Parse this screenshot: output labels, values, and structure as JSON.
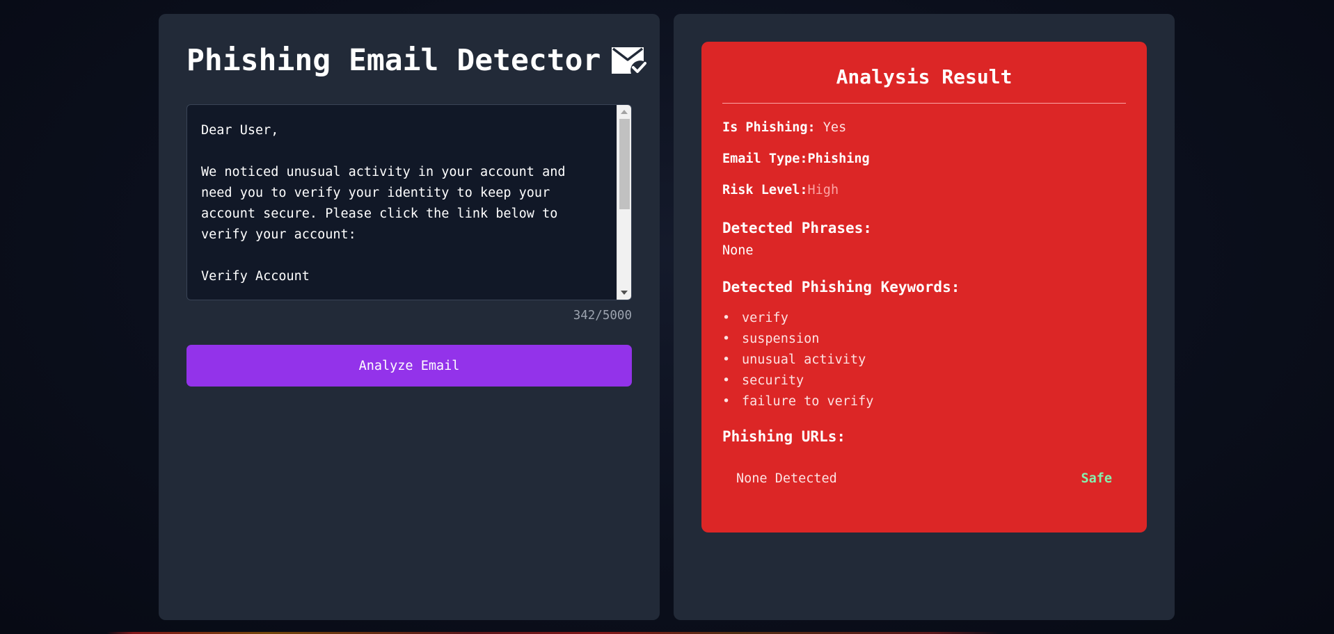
{
  "app": {
    "title": "Phishing Email Detector",
    "title_icon": "mail-check-icon"
  },
  "input": {
    "email_text": "Dear User,\n\nWe noticed unusual activity in your account and need you to verify your identity to keep your account secure. Please click the link below to verify your account:\n\nVerify Account",
    "char_count": "342/5000",
    "analyze_label": "Analyze Email"
  },
  "result": {
    "title": "Analysis Result",
    "is_phishing_label": "Is Phishing:",
    "is_phishing_value": "Yes",
    "email_type_label": "Email Type:",
    "email_type_value": "Phishing",
    "risk_level_label": "Risk Level:",
    "risk_level_value": "High",
    "detected_phrases_label": "Detected Phrases:",
    "detected_phrases_value": "None",
    "keywords_label": "Detected Phishing Keywords:",
    "keywords": [
      "verify",
      "suspension",
      "unusual activity",
      "security",
      "failure to verify"
    ],
    "urls_label": "Phishing URLs:",
    "url_text": "None Detected",
    "url_status": "Safe"
  },
  "colors": {
    "result_card": "#dc2626",
    "button": "#9333ea",
    "panel": "#222a38",
    "safe": "#86efac"
  }
}
